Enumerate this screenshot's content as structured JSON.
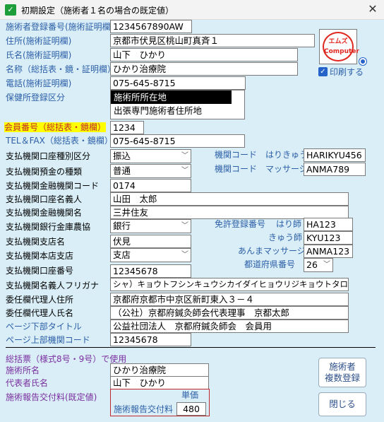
{
  "window": {
    "title": "初期設定（施術者１名の場合の既定値）",
    "close_label": "✕"
  },
  "fields": {
    "registration_no": {
      "label": "施術者登録番号(施術証明欄)",
      "value": "1234567890AW"
    },
    "address": {
      "label": "住所(施術証明欄)",
      "value": "京都市伏見区桃山町真斉１"
    },
    "name": {
      "label": "氏名(施術証明欄)",
      "value": "山下　ひかり"
    },
    "clinic_name": {
      "label": "名称（総括表・鏡・証明欄）",
      "value": "ひかり治療院"
    },
    "phone": {
      "label": "電話(施術証明欄)",
      "value": "075-645-8715"
    },
    "clinic_type": {
      "label": "保健所登録区分",
      "options": [
        "施術所所在地",
        "出張専門施術者住所地"
      ]
    },
    "member_no": {
      "label": "会員番号（総括表・鏡欄）",
      "value": "1234"
    },
    "tel_fax": {
      "label": "TEL＆FAX（総括表・鏡欄）",
      "value": "075-645-8715"
    },
    "payment_type": {
      "label": "支払機関口座種別区分",
      "value": "振込"
    },
    "deposit_type": {
      "label": "支払機関預金の種類",
      "value": "普通"
    },
    "bank_code": {
      "label": "支払機関金融機関コード",
      "value": "0174"
    },
    "account_holder": {
      "label": "支払機関口座名義人",
      "value": "山田　太郎"
    },
    "bank_name": {
      "label": "支払機関金融機関名",
      "value": "三井住友"
    },
    "bank_kind": {
      "label": "支払機関銀行金庫農協",
      "value": "銀行"
    },
    "branch_name": {
      "label": "支払機関支店名",
      "value": "伏見"
    },
    "branch_kind": {
      "label": "支払機関本店支店",
      "value": "支店"
    },
    "account_no": {
      "label": "支払機関口座番号",
      "value": "12345678"
    },
    "holder_kana": {
      "label": "支払機関名義人フリガナ",
      "value": "シャ）キョウトフシンキュウシカイダイヒョウリジキョウトタロウ"
    },
    "agent_address": {
      "label": "委任欄代理人住所",
      "value": "京都府京都市中京区新町東入３－４"
    },
    "agent_name": {
      "label": "委任欄代理人氏名",
      "value": "（公社）京都府鍼灸師会代表理事　京都太郎"
    },
    "footer_title": {
      "label": "ページ下部タイトル",
      "value": "公益社団法人　京都府鍼灸師会　会員用"
    },
    "header_code": {
      "label": "ページ上部機関コード",
      "value": "12345678"
    }
  },
  "right_codes": {
    "harikyu": {
      "label": "機関コード　はりきゅう",
      "value": "HARIKYU456"
    },
    "massage": {
      "label": "機関コード　マッサージ",
      "value": "ANMA789"
    },
    "exempt_label": "免許登録番号",
    "hari": {
      "label": "はり師",
      "value": "HA123"
    },
    "kyu": {
      "label": "きゅう師",
      "value": "KYU123"
    },
    "anma": {
      "label": "あんまマッサージ",
      "value": "ANMA123"
    },
    "prefecture": {
      "label": "都道府県番号",
      "value": "26"
    }
  },
  "logo": {
    "line1": "エムズ",
    "line2": "Computer"
  },
  "print_checkbox": {
    "label": "印刷する"
  },
  "summary": {
    "heading": "総括票（様式8号・9号）で使用",
    "clinic": {
      "label": "施術所名",
      "value": "ひかり治療院"
    },
    "representative": {
      "label": "代表者氏名",
      "value": "山下　ひかり"
    },
    "fee": {
      "label": "施術報告交付料(既定値)",
      "unit_label": "単価",
      "inner_label": "施術報告交付料",
      "value": "480"
    }
  },
  "buttons": {
    "multi_line1": "施術者",
    "multi_line2": "複数登録",
    "close": "閉じる"
  },
  "colors": {
    "label_blue": "#2d5fa8",
    "highlight": "#ffff00",
    "accent_red": "#c0282d",
    "check_blue": "#2563c9"
  }
}
